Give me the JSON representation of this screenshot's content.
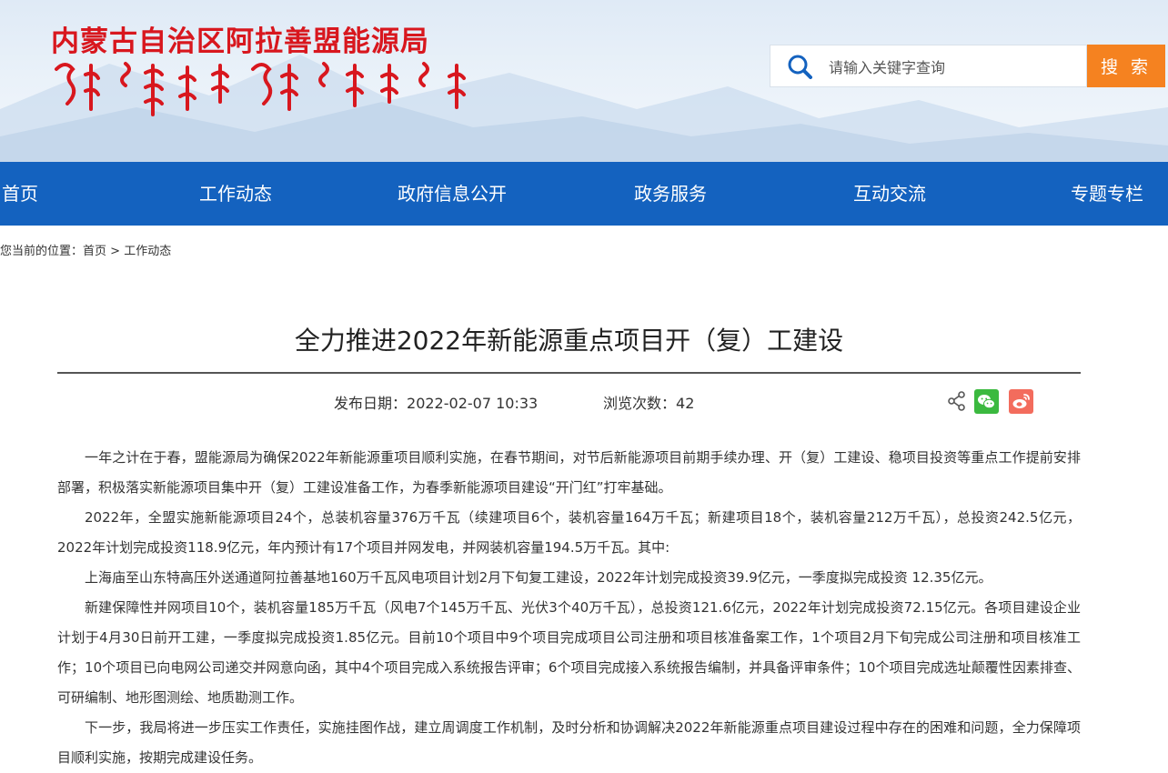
{
  "header": {
    "site_title": "内蒙古自治区阿拉善盟能源局",
    "search": {
      "placeholder": "请输入关键字查询",
      "button_label": "搜 索"
    }
  },
  "nav": {
    "items": [
      {
        "label": "首页"
      },
      {
        "label": "工作动态"
      },
      {
        "label": "政府信息公开"
      },
      {
        "label": "政务服务"
      },
      {
        "label": "互动交流"
      },
      {
        "label": "专题专栏"
      }
    ]
  },
  "breadcrumb": {
    "prefix": "您当前的位置：",
    "home": "首页",
    "separator": ">",
    "current": "工作动态"
  },
  "article": {
    "title": "全力推进2022年新能源重点项目开（复）工建设",
    "publish_label": "发布日期：",
    "publish_date": "2022-02-07 10:33",
    "views_label": "浏览次数：",
    "views": "42",
    "paragraphs": [
      "一年之计在于春，盟能源局为确保2022年新能源重项目顺利实施，在春节期间，对节后新能源项目前期手续办理、开（复）工建设、稳项目投资等重点工作提前安排部署，积极落实新能源项目集中开（复）工建设准备工作，为春季新能源项目建设“开门红”打牢基础。",
      "2022年，全盟实施新能源项目24个，总装机容量376万千瓦（续建项目6个，装机容量164万千瓦；新建项目18个，装机容量212万千瓦），总投资242.5亿元，2022年计划完成投资118.9亿元，年内预计有17个项目并网发电，并网装机容量194.5万千瓦。其中:",
      "上海庙至山东特高压外送通道阿拉善基地160万千瓦风电项目计划2月下旬复工建设，2022年计划完成投资39.9亿元，一季度拟完成投资 12.35亿元。",
      "新建保障性并网项目10个，装机容量185万千瓦（风电7个145万千瓦、光伏3个40万千瓦），总投资121.6亿元，2022年计划完成投资72.15亿元。各项目建设企业计划于4月30日前开工建，一季度拟完成投资1.85亿元。目前10个项目中9个项目完成项目公司注册和项目核准备案工作，1个项目2月下旬完成公司注册和项目核准工作；10个项目已向电网公司递交并网意向函，其中4个项目完成入系统报告评审；6个项目完成接入系统报告编制，并具备评审条件；10个项目完成选址颠覆性因素排查、可研编制、地形图测绘、地质勘测工作。",
      "下一步，我局将进一步压实工作责任，实施挂图作战，建立周调度工作机制，及时分析和协调解决2022年新能源重点项目建设过程中存在的困难和问题，全力保障项目顺利实施，按期完成建设任务。"
    ]
  },
  "colors": {
    "title_red": "#d8171e",
    "nav_blue": "#1462bf",
    "search_orange": "#f58220",
    "wechat_green": "#3bb93f",
    "weibo_red": "#f36c5d"
  },
  "icons": [
    "search-icon",
    "share-icon",
    "wechat-icon",
    "weibo-icon",
    "mongolian-script-logo"
  ]
}
